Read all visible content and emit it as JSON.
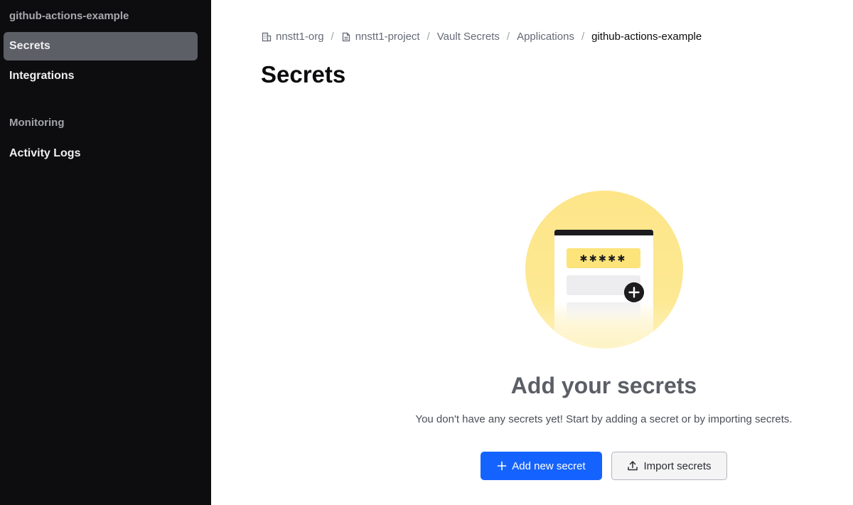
{
  "sidebar": {
    "app_name": "github-actions-example",
    "items": [
      {
        "label": "Secrets",
        "active": true
      },
      {
        "label": "Integrations",
        "active": false
      }
    ],
    "section_label": "Monitoring",
    "section_items": [
      {
        "label": "Activity Logs"
      }
    ]
  },
  "breadcrumb": [
    {
      "label": "nnstt1-org",
      "icon": "org-icon"
    },
    {
      "label": "nnstt1-project",
      "icon": "project-icon"
    },
    {
      "label": "Vault Secrets"
    },
    {
      "label": "Applications"
    },
    {
      "label": "github-actions-example",
      "current": true
    }
  ],
  "breadcrumb_separator": "/",
  "page": {
    "title": "Secrets"
  },
  "empty_state": {
    "illustration_mask": "✱✱✱✱✱",
    "title": "Add your secrets",
    "text": "You don't have any secrets yet! Start by adding a secret or by importing secrets.",
    "primary_button": "Add new secret",
    "secondary_button": "Import secrets"
  },
  "colors": {
    "sidebar_bg": "#0d0d0f",
    "active_item_bg": "#5d5f66",
    "primary": "#1563ff",
    "illustration_yellow": "#fde588"
  }
}
